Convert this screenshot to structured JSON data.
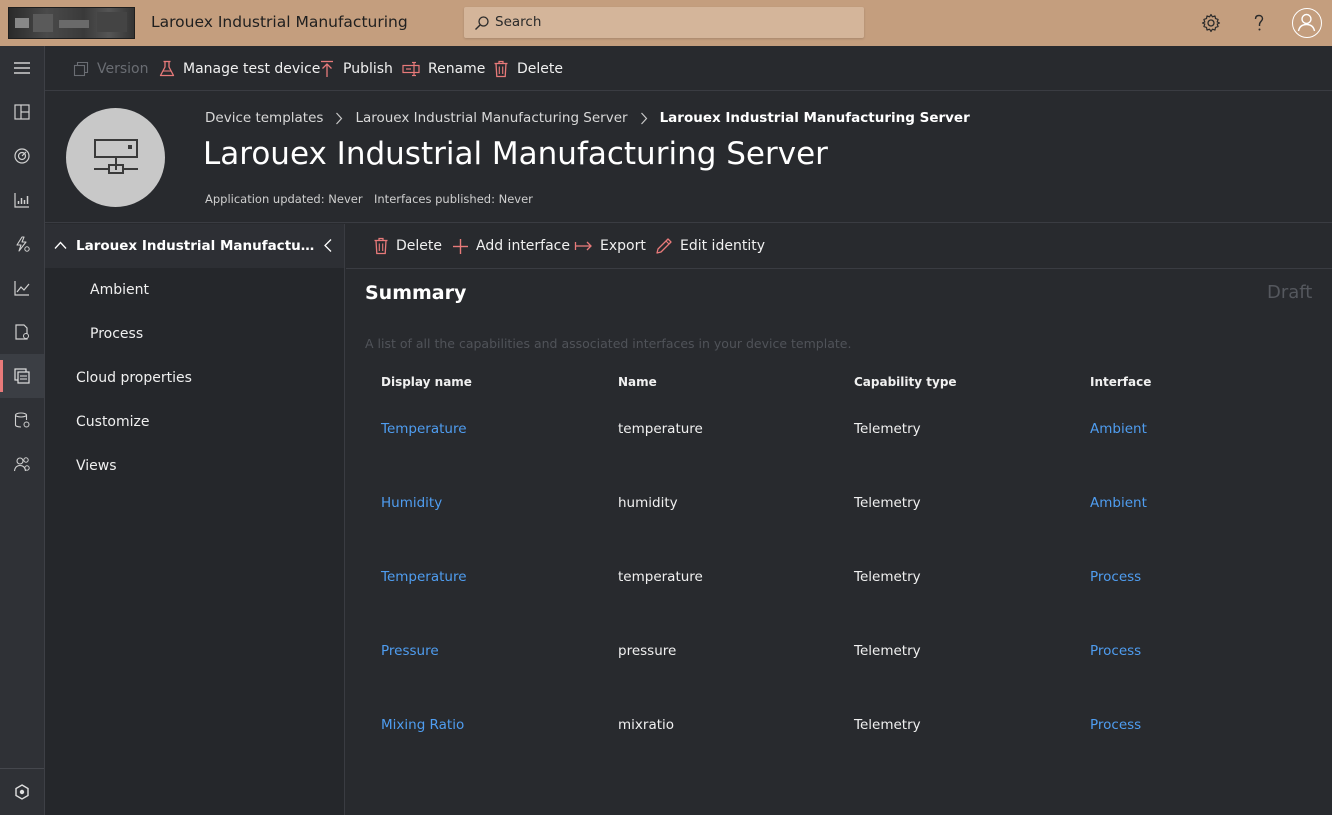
{
  "app": {
    "title": "Larouex Industrial Manufacturing"
  },
  "search": {
    "placeholder": "Search"
  },
  "toolbar": {
    "version": "Version",
    "manage_test_device": "Manage test device",
    "publish": "Publish",
    "rename": "Rename",
    "delete": "Delete"
  },
  "breadcrumb": {
    "items": [
      "Device templates",
      "Larouex Industrial Manufacturing Server",
      "Larouex Industrial Manufacturing Server"
    ]
  },
  "page": {
    "title": "Larouex Industrial Manufacturing Server",
    "application_updated": "Application updated: Never",
    "interfaces_published": "Interfaces published: Never"
  },
  "tree": {
    "root": "Larouex Industrial Manufacturing Server",
    "children": [
      "Ambient",
      "Process"
    ],
    "sections": [
      "Cloud properties",
      "Customize",
      "Views"
    ]
  },
  "content_toolbar": {
    "delete": "Delete",
    "add_interface": "Add interface",
    "export": "Export",
    "edit_identity": "Edit identity"
  },
  "summary": {
    "title": "Summary",
    "status": "Draft",
    "description": "A list of all the capabilities and associated interfaces in your device template.",
    "columns": [
      "Display name",
      "Name",
      "Capability type",
      "Interface"
    ],
    "rows": [
      {
        "display_name": "Temperature",
        "name": "temperature",
        "capability_type": "Telemetry",
        "interface": "Ambient"
      },
      {
        "display_name": "Humidity",
        "name": "humidity",
        "capability_type": "Telemetry",
        "interface": "Ambient"
      },
      {
        "display_name": "Temperature",
        "name": "temperature",
        "capability_type": "Telemetry",
        "interface": "Process"
      },
      {
        "display_name": "Pressure",
        "name": "pressure",
        "capability_type": "Telemetry",
        "interface": "Process"
      },
      {
        "display_name": "Mixing Ratio",
        "name": "mixratio",
        "capability_type": "Telemetry",
        "interface": "Process"
      }
    ]
  },
  "colors": {
    "topbar": "#c49e7e",
    "accent": "#e87a7a",
    "link": "#4f9df0",
    "background": "#282a2e"
  }
}
